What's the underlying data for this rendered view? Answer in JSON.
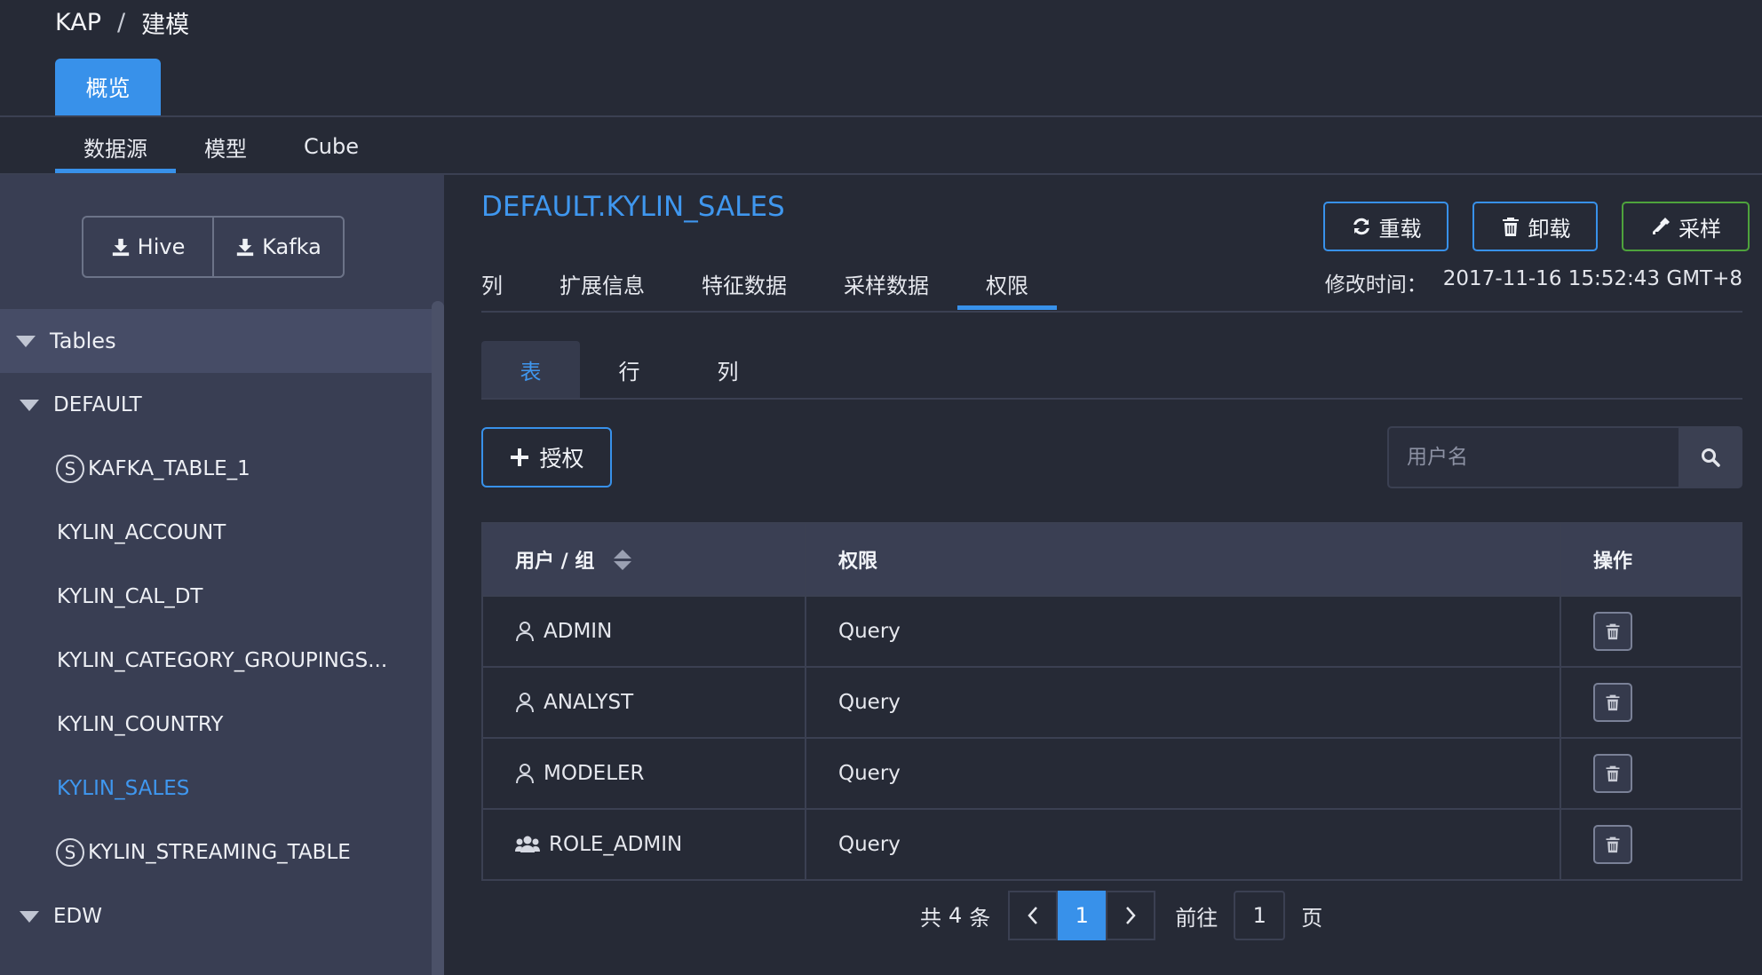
{
  "breadcrumb": {
    "root": "KAP",
    "separator": "/",
    "current": "建模"
  },
  "top_tab": "概览",
  "subnav": [
    "数据源",
    "模型",
    "Cube"
  ],
  "sidebar": {
    "source_buttons": [
      "Hive",
      "Kafka"
    ],
    "tree": {
      "root": "Tables",
      "databases": [
        {
          "name": "DEFAULT",
          "tables": [
            {
              "name": "KAFKA_TABLE_1",
              "streaming": true
            },
            {
              "name": "KYLIN_ACCOUNT"
            },
            {
              "name": "KYLIN_CAL_DT"
            },
            {
              "name": "KYLIN_CATEGORY_GROUPINGS..."
            },
            {
              "name": "KYLIN_COUNTRY"
            },
            {
              "name": "KYLIN_SALES",
              "selected": true
            },
            {
              "name": "KYLIN_STREAMING_TABLE",
              "streaming": true
            }
          ]
        },
        {
          "name": "EDW"
        }
      ],
      "streaming_badge": "S"
    }
  },
  "main": {
    "table_title": "DEFAULT.KYLIN_SALES",
    "actions": {
      "reload": "重载",
      "unload": "卸载",
      "sample": "采样"
    },
    "tabs": [
      "列",
      "扩展信息",
      "特征数据",
      "采样数据",
      "权限"
    ],
    "active_tab": "权限",
    "modified_label": "修改时间：",
    "modified_value": "2017-11-16 15:52:43 GMT+8",
    "perm_tabs": [
      "表",
      "行",
      "列"
    ],
    "grant_button": "授权",
    "search": {
      "placeholder": "用户名"
    },
    "table": {
      "headers": [
        "用户 / 组",
        "权限",
        "操作"
      ],
      "rows": [
        {
          "name": "ADMIN",
          "type": "user",
          "permission": "Query"
        },
        {
          "name": "ANALYST",
          "type": "user",
          "permission": "Query"
        },
        {
          "name": "MODELER",
          "type": "user",
          "permission": "Query"
        },
        {
          "name": "ROLE_ADMIN",
          "type": "group",
          "permission": "Query"
        }
      ]
    },
    "pagination": {
      "total_prefix": "共",
      "total": "4",
      "total_suffix": "条",
      "current": "1",
      "goto_prefix": "前往",
      "goto_value": "1",
      "goto_suffix": "页"
    }
  },
  "colors": {
    "accent": "#3891ea",
    "sample_border": "#4ea33c",
    "background": "#262a36",
    "sidebar": "#393e53"
  }
}
